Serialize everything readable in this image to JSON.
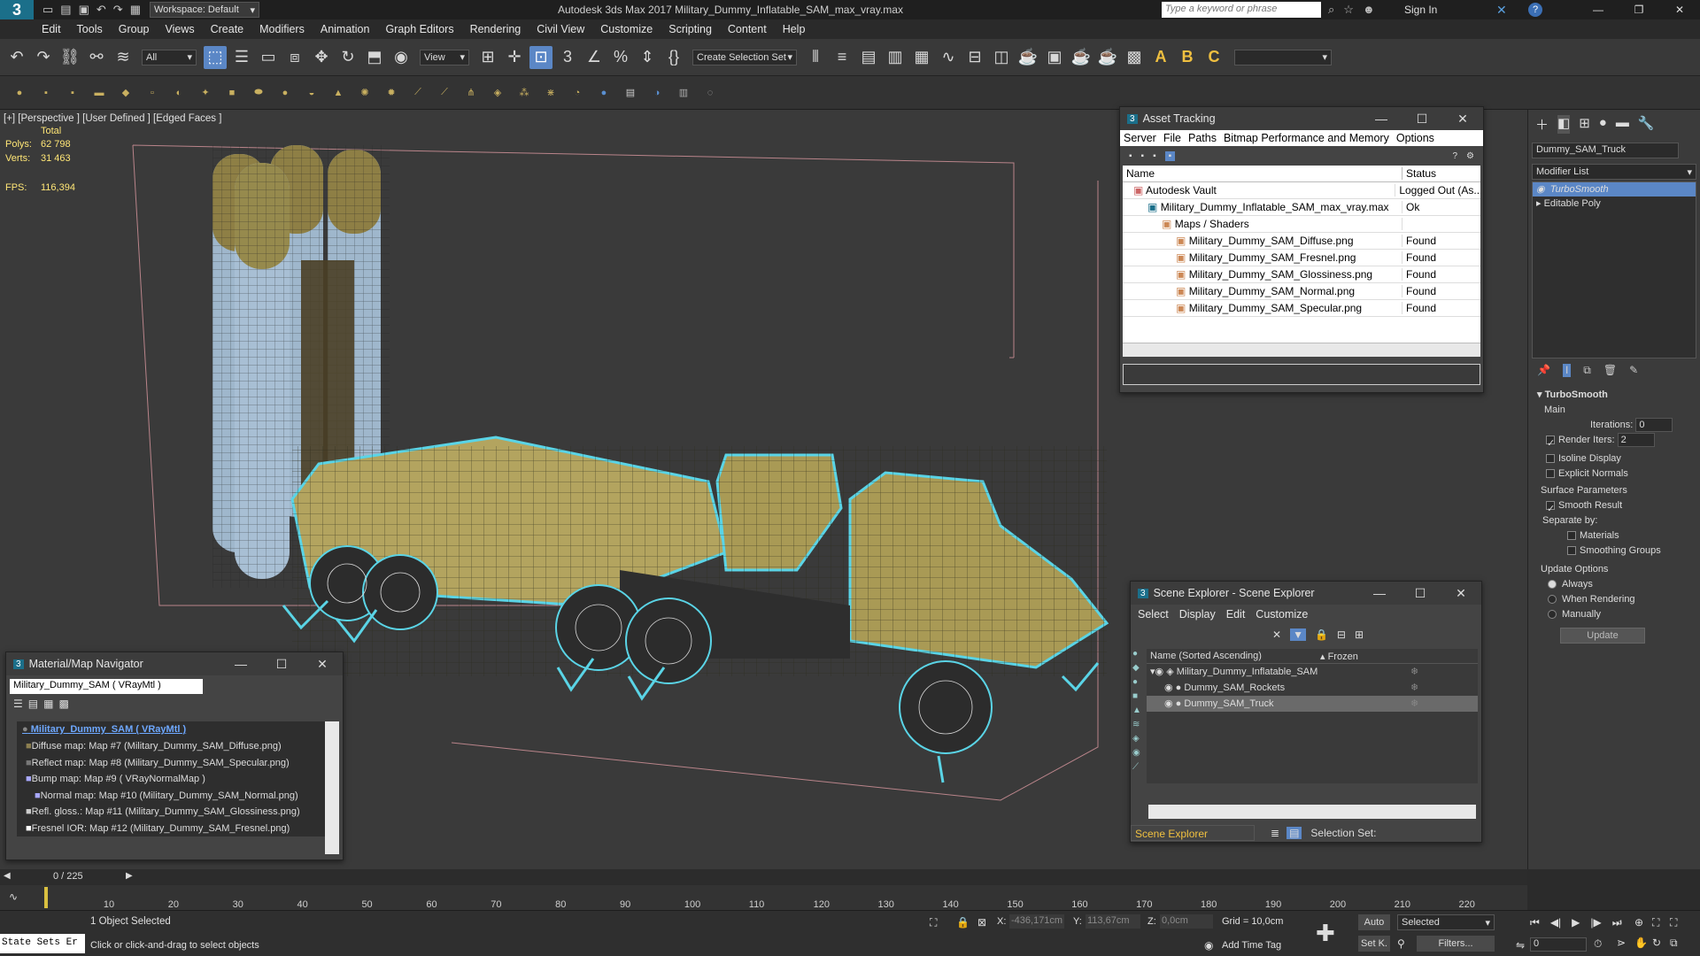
{
  "app": {
    "title": "Autodesk 3ds Max 2017     Military_Dummy_Inflatable_SAM_max_vray.max",
    "workspace": "Workspace: Default",
    "search_placeholder": "Type a keyword or phrase",
    "sign_in": "Sign In"
  },
  "menu": [
    "Edit",
    "Tools",
    "Group",
    "Views",
    "Create",
    "Modifiers",
    "Animation",
    "Graph Editors",
    "Rendering",
    "Civil View",
    "Customize",
    "Scripting",
    "Content",
    "Help"
  ],
  "toolbar": {
    "filter": "All",
    "ref_coord": "View",
    "selection_set": "Create Selection Set"
  },
  "viewport": {
    "label": "[+] [Perspective ] [User Defined ] [Edged Faces ]",
    "stats_total": "Total",
    "polys_label": "Polys:",
    "polys_value": "62 798",
    "verts_label": "Verts:",
    "verts_value": "31 463",
    "fps_label": "FPS:",
    "fps_value": "116,394"
  },
  "asset_tracking": {
    "title": "Asset Tracking",
    "menu": [
      "Server",
      "File",
      "Paths",
      "Bitmap Performance and Memory",
      "Options"
    ],
    "col_name": "Name",
    "col_status": "Status",
    "rows": [
      {
        "name": "Autodesk Vault",
        "status": "Logged Out (As..."
      },
      {
        "name": "Military_Dummy_Inflatable_SAM_max_vray.max",
        "status": "Ok"
      },
      {
        "name": "Maps / Shaders",
        "status": ""
      },
      {
        "name": "Military_Dummy_SAM_Diffuse.png",
        "status": "Found"
      },
      {
        "name": "Military_Dummy_SAM_Fresnel.png",
        "status": "Found"
      },
      {
        "name": "Military_Dummy_SAM_Glossiness.png",
        "status": "Found"
      },
      {
        "name": "Military_Dummy_SAM_Normal.png",
        "status": "Found"
      },
      {
        "name": "Military_Dummy_SAM_Specular.png",
        "status": "Found"
      }
    ]
  },
  "material_nav": {
    "title": "Material/Map Navigator",
    "field": "Military_Dummy_SAM  ( VRayMtl )",
    "root": "Military_Dummy_SAM  ( VRayMtl )",
    "items": [
      "Diffuse map: Map #7 (Military_Dummy_SAM_Diffuse.png)",
      "Reflect map: Map #8 (Military_Dummy_SAM_Specular.png)",
      "Bump map: Map #9  ( VRayNormalMap )",
      "Normal map: Map #10 (Military_Dummy_SAM_Normal.png)",
      "Refl. gloss.: Map #11 (Military_Dummy_SAM_Glossiness.png)",
      "Fresnel IOR: Map #12 (Military_Dummy_SAM_Fresnel.png)"
    ]
  },
  "scene_explorer": {
    "title": "Scene Explorer - Scene Explorer",
    "menu": [
      "Select",
      "Display",
      "Edit",
      "Customize"
    ],
    "col_name": "Name (Sorted Ascending)",
    "col_frozen": "▴ Frozen",
    "items": [
      "Military_Dummy_Inflatable_SAM",
      "Dummy_SAM_Rockets",
      "Dummy_SAM_Truck"
    ],
    "footer_name": "Scene Explorer",
    "footer_sel": "Selection Set:"
  },
  "command_panel": {
    "object_name": "Dummy_SAM_Truck",
    "modifier_list": "Modifier List",
    "stack": [
      "TurboSmooth",
      "Editable Poly"
    ],
    "rollout": "TurboSmooth",
    "main": "Main",
    "iterations_label": "Iterations:",
    "iterations": "0",
    "render_iters_label": "Render Iters:",
    "render_iters": "2",
    "isoline": "Isoline Display",
    "explicit": "Explicit Normals",
    "surface_params": "Surface Parameters",
    "smooth_result": "Smooth Result",
    "separate_by": "Separate by:",
    "materials": "Materials",
    "smoothing_groups": "Smoothing Groups",
    "update_options": "Update Options",
    "always": "Always",
    "when_rendering": "When Rendering",
    "manually": "Manually",
    "update_btn": "Update"
  },
  "timeline": {
    "frame": "0 / 225",
    "ticks": [
      "10",
      "20",
      "30",
      "40",
      "50",
      "60",
      "70",
      "80",
      "90",
      "100",
      "110",
      "120",
      "130",
      "140",
      "150",
      "160",
      "170",
      "180",
      "190",
      "200",
      "210",
      "220"
    ]
  },
  "status": {
    "maxscript": "State Sets Er",
    "selected": "1 Object Selected",
    "prompt": "Click or click-and-drag to select objects",
    "x_label": "X:",
    "x": "-436,171cm",
    "y_label": "Y:",
    "y": "113,67cm",
    "z_label": "Z:",
    "z": "0,0cm",
    "grid": "Grid = 10,0cm",
    "add_time_tag": "Add Time Tag",
    "auto": "Auto",
    "set_key": "Set K.",
    "selected_dd": "Selected",
    "filters": "Filters...",
    "frame_field": "0"
  }
}
